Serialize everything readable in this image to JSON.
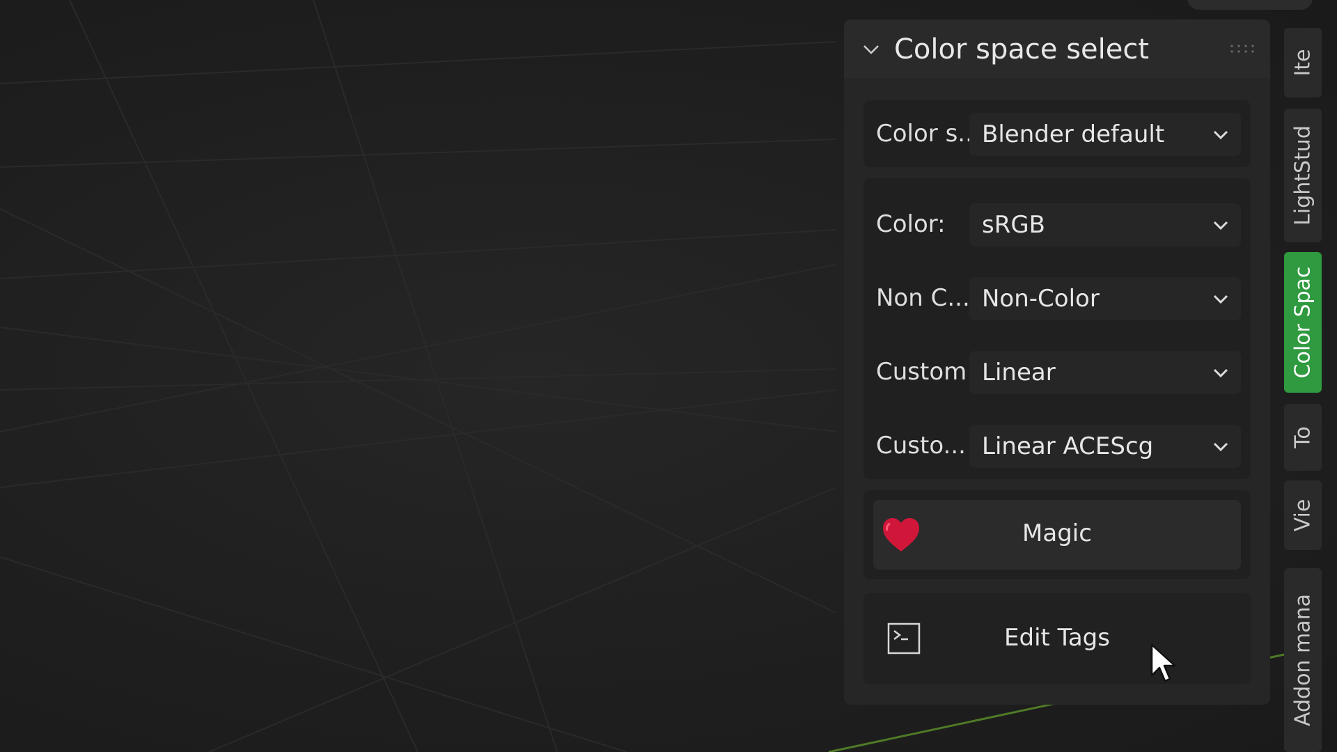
{
  "panel": {
    "title": "Color space select",
    "preset": {
      "label": "Color s...",
      "value": "Blender default"
    },
    "rows": [
      {
        "label": "Color:",
        "value": "sRGB"
      },
      {
        "label": "Non C...",
        "value": "Non-Color"
      },
      {
        "label": "Custom:",
        "value": "Linear"
      },
      {
        "label": "Custo...",
        "value": "Linear ACEScg"
      }
    ],
    "magic_button": {
      "label": "Magic",
      "icon": "heart-icon"
    },
    "edit_tags_button": {
      "label": "Edit Tags",
      "icon": "console-icon"
    }
  },
  "tabs": [
    {
      "label": "Ite",
      "active": false
    },
    {
      "label": "LightStud",
      "active": false
    },
    {
      "label": "Color Spac",
      "active": true
    },
    {
      "label": "To",
      "active": false
    },
    {
      "label": "Vie",
      "active": false
    },
    {
      "label": "Addon mana",
      "active": false
    }
  ],
  "colors": {
    "active_tab": "#2f9a3f",
    "heart": "#d0173a",
    "panel_bg": "#262626",
    "viewport_bg": "#1d1d1d"
  }
}
